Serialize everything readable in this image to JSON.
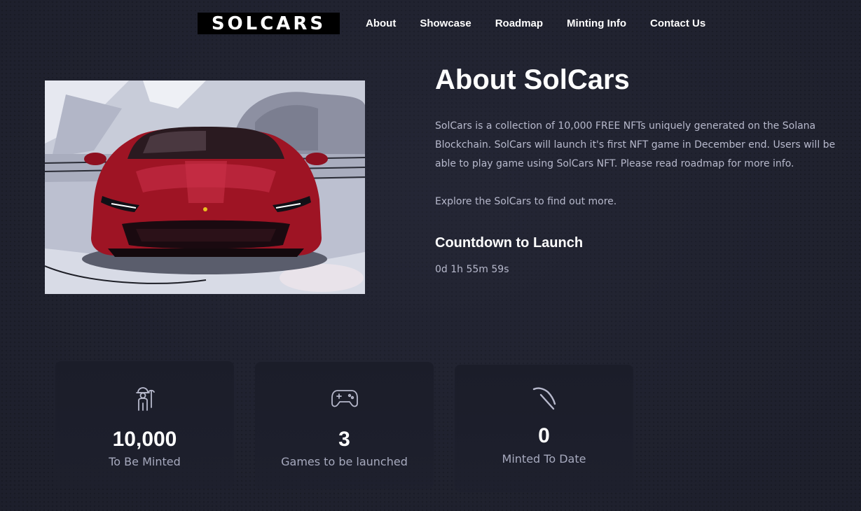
{
  "header": {
    "logo_text": "SOLCARS",
    "nav": [
      {
        "label": "About"
      },
      {
        "label": "Showcase"
      },
      {
        "label": "Roadmap"
      },
      {
        "label": "Minting Info"
      },
      {
        "label": "Contact Us"
      }
    ]
  },
  "about": {
    "title": "About SolCars",
    "description": "SolCars is a collection of 10,000 FREE NFTs uniquely generated on the Solana Blockchain. SolCars will launch it's first NFT game in December end. Users will be able to play game using SolCars NFT. Please read roadmap for more info.",
    "explore": "Explore the SolCars to find out more.",
    "countdown_title": "Countdown to Launch",
    "countdown_value": "0d 1h 55m 59s"
  },
  "stats": [
    {
      "icon": "miner-icon",
      "number": "10,000",
      "label": "To Be Minted"
    },
    {
      "icon": "gamepad-icon",
      "number": "3",
      "label": "Games to be launched"
    },
    {
      "icon": "pickaxe-icon",
      "number": "0",
      "label": "Minted To Date"
    }
  ],
  "colors": {
    "background": "#20222f",
    "card": "#1b1d29",
    "body_text": "#b7b9cc",
    "car_red": "#9e1424"
  }
}
